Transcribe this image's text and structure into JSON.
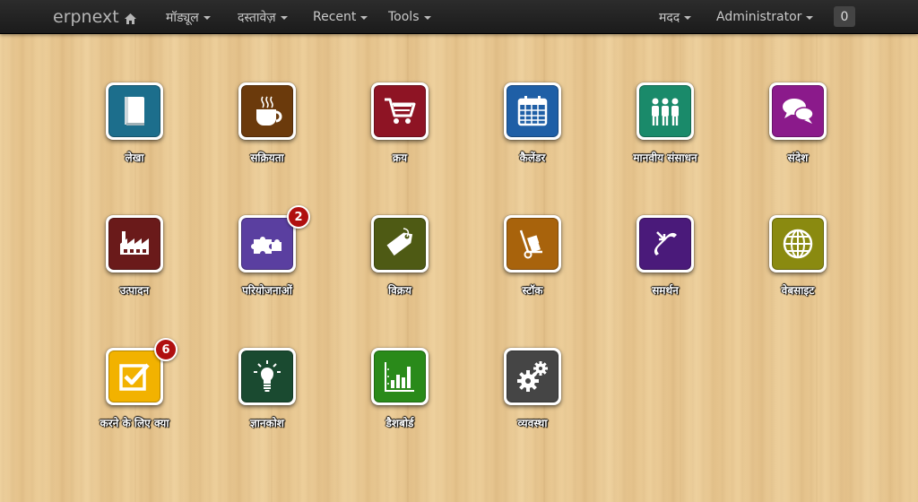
{
  "navbar": {
    "brand": "erpnext",
    "brand_icon": "home-icon",
    "menus": [
      {
        "label": "मॉड्यूल"
      },
      {
        "label": "दस्तावेज़"
      },
      {
        "label": "Recent"
      },
      {
        "label": "Tools"
      }
    ],
    "help_label": "मदद",
    "user_label": "Administrator",
    "notification_count": "0"
  },
  "apps": [
    {
      "label": "लेखा",
      "icon": "book-icon",
      "color": "#1c6e8c"
    },
    {
      "label": "सक्रियता",
      "icon": "coffee-icon",
      "color": "#6b3a0c"
    },
    {
      "label": "क्रय",
      "icon": "shopping-cart-icon",
      "color": "#8e1424"
    },
    {
      "label": "कैलेंडर",
      "icon": "calendar-icon",
      "color": "#1f5fa6"
    },
    {
      "label": "मानवीय संसाधन",
      "icon": "people-icon",
      "color": "#1a8a6a"
    },
    {
      "label": "संदेश",
      "icon": "chat-icon",
      "color": "#8b1a8b"
    },
    {
      "label": "उत्पादन",
      "icon": "factory-icon",
      "color": "#6a1a1a"
    },
    {
      "label": "परियोजनाओं",
      "icon": "puzzle-icon",
      "color": "#5a3fa0",
      "badge": "2"
    },
    {
      "label": "विक्रय",
      "icon": "tag-icon",
      "color": "#4e5a14"
    },
    {
      "label": "स्टॉक",
      "icon": "hand-truck-icon",
      "color": "#a8630c"
    },
    {
      "label": "समर्थन",
      "icon": "phone-icon",
      "color": "#4a1a7a"
    },
    {
      "label": "वेबसाइट",
      "icon": "globe-icon",
      "color": "#8a8a10"
    },
    {
      "label": "करने के लिए क्या",
      "icon": "checkbox-icon",
      "color": "#f2b200",
      "badge": "6"
    },
    {
      "label": "ज्ञानकोश",
      "icon": "lightbulb-icon",
      "color": "#1a4a30"
    },
    {
      "label": "डैशबोर्ड",
      "icon": "bar-chart-icon",
      "color": "#2a8a1a"
    },
    {
      "label": "व्यवस्था",
      "icon": "gears-icon",
      "color": "#454545"
    }
  ]
}
